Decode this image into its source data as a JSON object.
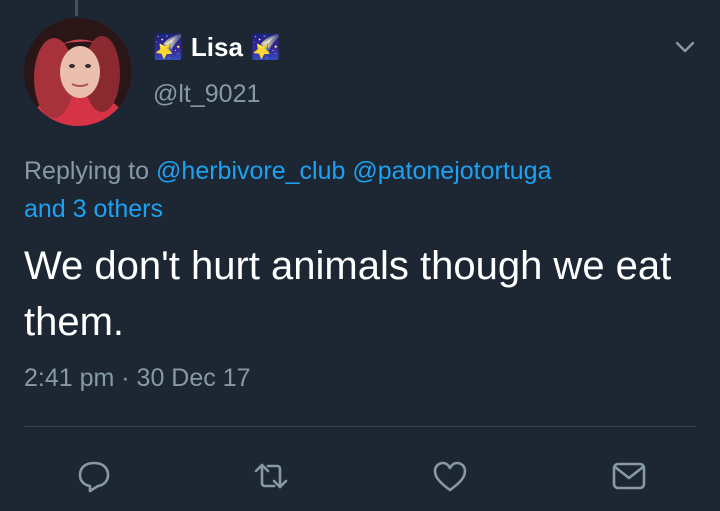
{
  "tweet": {
    "author": {
      "name": "Lisa",
      "emoji": "🌠",
      "handle": "@lt_9021",
      "avatar_icon": "profile-photo"
    },
    "replying": {
      "prefix": "Replying to ",
      "mention1": "@herbivore_club",
      "mention2": "@patonejotortuga",
      "others": "and 3 others"
    },
    "text": "We don't hurt animals though we eat them.",
    "timestamp": "2:41 pm · 30 Dec 17"
  },
  "actions": {
    "reply_icon": "reply-icon",
    "retweet_icon": "retweet-icon",
    "like_icon": "heart-icon",
    "message_icon": "mail-icon"
  },
  "colors": {
    "background": "#1c2733",
    "accent": "#1da1f2",
    "secondary_text": "#8899a6",
    "divider": "#38444d"
  }
}
